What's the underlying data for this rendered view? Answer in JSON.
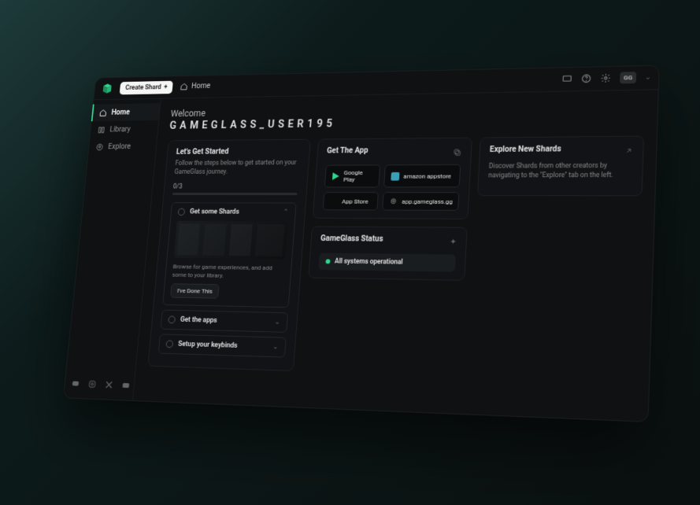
{
  "topbar": {
    "create_label": "Create Shard",
    "breadcrumb_label": "Home",
    "avatar_badge": "GG"
  },
  "sidebar": {
    "items": [
      {
        "label": "Home"
      },
      {
        "label": "Library"
      },
      {
        "label": "Explore"
      }
    ]
  },
  "welcome": {
    "greeting": "Welcome",
    "username": "GAMEGLASS_USER195"
  },
  "get_started": {
    "title": "Let's Get Started",
    "subtitle": "Follow the steps below to get started on your GameGlass journey.",
    "progress": "0/3",
    "steps": [
      {
        "title": "Get some Shards",
        "description": "Browse for game experiences, and add some to your library.",
        "button": "I've Done This"
      },
      {
        "title": "Get the apps"
      },
      {
        "title": "Setup your keybinds"
      }
    ]
  },
  "get_app": {
    "title": "Get The App",
    "buttons": [
      {
        "label": "Google Play"
      },
      {
        "label": "amazon appstore"
      },
      {
        "label": "App Store"
      },
      {
        "label": "app.gameglass.gg"
      }
    ]
  },
  "status": {
    "title": "GameGlass Status",
    "message": "All systems operational"
  },
  "explore": {
    "title": "Explore New Shards",
    "body": "Discover Shards from other creators by navigating to the \"Explore\" tab on the left."
  }
}
